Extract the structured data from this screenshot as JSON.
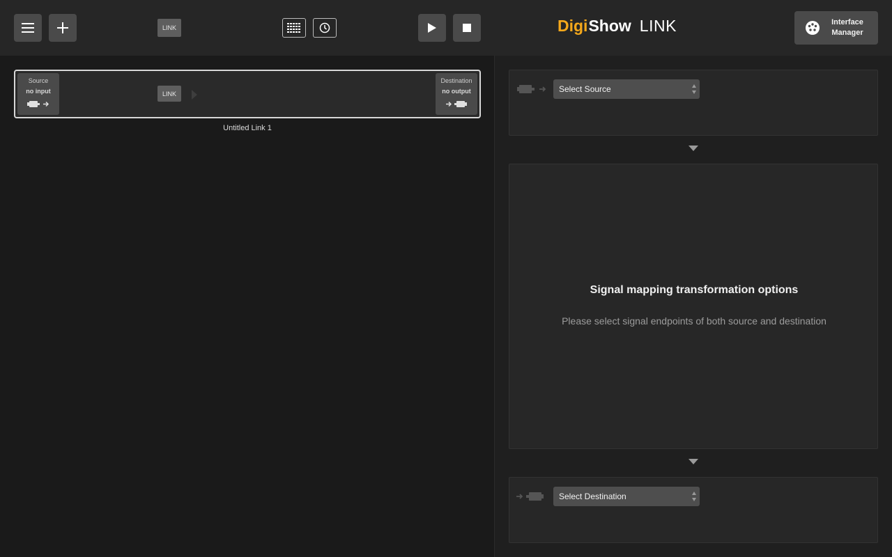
{
  "toolbar": {
    "menu_icon": "hamburger-menu-icon",
    "add_icon": "plus-icon",
    "link_label": "LINK",
    "grid_icon": "grid-icon",
    "clock_icon": "clock-icon",
    "play_icon": "play-icon",
    "stop_icon": "stop-icon"
  },
  "brand": {
    "digi": "Digi",
    "show": "Show",
    "link": "LINK",
    "accent_color": "#f5a81b"
  },
  "interface_manager": {
    "label_line1": "Interface",
    "label_line2": "Manager",
    "icon": "dmx-connector-icon"
  },
  "link_card": {
    "source_title": "Source",
    "source_status": "no input",
    "link_label": "LINK",
    "destination_title": "Destination",
    "destination_status": "no output",
    "name": "Untitled Link 1"
  },
  "source_panel": {
    "select_label": "Select Source",
    "icon": "plug-out-icon"
  },
  "mapping_panel": {
    "title": "Signal mapping transformation options",
    "subtitle": "Please select signal endpoints of both source and destination"
  },
  "destination_panel": {
    "select_label": "Select Destination",
    "icon": "plug-in-icon"
  }
}
